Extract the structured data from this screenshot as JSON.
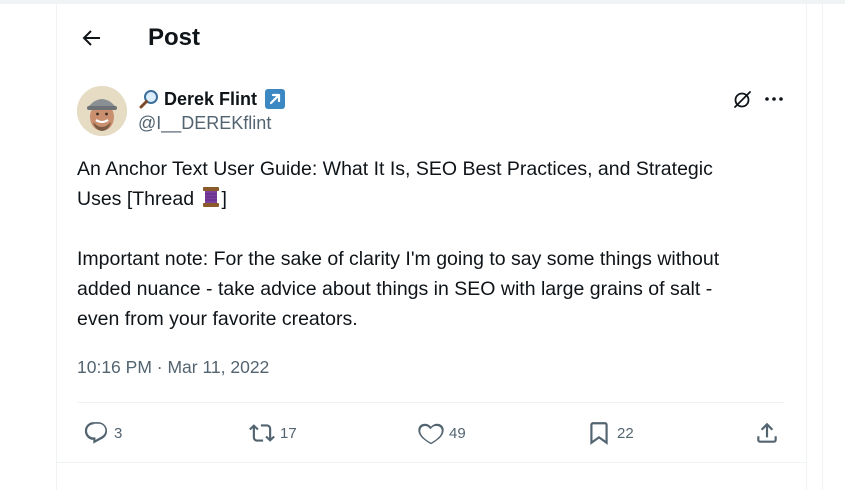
{
  "header": {
    "title": "Post"
  },
  "author": {
    "name": "Derek Flint",
    "handle": "@I__DEREKflint"
  },
  "post": {
    "line1": "An Anchor Text User Guide: What It Is, SEO Best Practices, and Strategic",
    "line2_prefix": "Uses [Thread ",
    "line2_suffix": "]",
    "paragraph2": "Important note: For the sake of clarity I'm going to say some things without added nuance - take advice about things in SEO with large grains of salt - even from your favorite creators.",
    "timestamp": "10:16 PM · Mar 11, 2022"
  },
  "actions": {
    "replies": "3",
    "reposts": "17",
    "likes": "49",
    "bookmarks": "22"
  },
  "colors": {
    "accent": "#1d9bf0",
    "muted": "#536471",
    "border": "#eff3f4"
  },
  "icons": [
    "back-arrow-icon",
    "magnifying-glass-icon",
    "verified-badge-icon",
    "grok-icon",
    "more-icon",
    "spool-of-thread-icon",
    "reply-icon",
    "repost-icon",
    "like-icon",
    "bookmark-icon",
    "share-icon"
  ]
}
